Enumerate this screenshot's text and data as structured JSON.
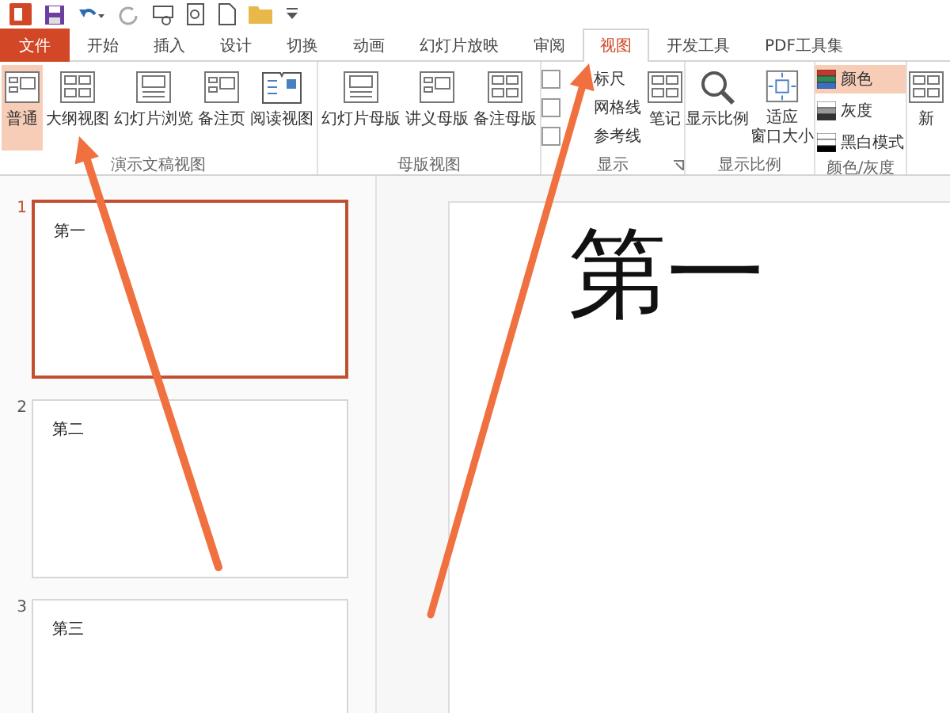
{
  "tabs": [
    {
      "label": "文件",
      "kind": "file"
    },
    {
      "label": "开始",
      "kind": "tab",
      "selected": false
    },
    {
      "label": "插入",
      "kind": "tab",
      "selected": false
    },
    {
      "label": "设计",
      "kind": "tab",
      "selected": false
    },
    {
      "label": "切换",
      "kind": "tab",
      "selected": false
    },
    {
      "label": "动画",
      "kind": "tab",
      "selected": false
    },
    {
      "label": "幻灯片放映",
      "kind": "tab",
      "selected": false
    },
    {
      "label": "审阅",
      "kind": "tab",
      "selected": false
    },
    {
      "label": "视图",
      "kind": "tab",
      "selected": true
    },
    {
      "label": "开发工具",
      "kind": "tab",
      "selected": false
    },
    {
      "label": "PDF工具集",
      "kind": "tab",
      "selected": false
    }
  ],
  "ribbon": {
    "groups": [
      {
        "label": "演示文稿视图",
        "items": [
          {
            "kind": "large",
            "label": "普通",
            "selected": true
          },
          {
            "kind": "large",
            "label": "大纲视图",
            "selected": false
          },
          {
            "kind": "large",
            "label": "幻灯片浏览",
            "selected": false
          },
          {
            "kind": "large",
            "label": "备注页",
            "selected": false
          },
          {
            "kind": "large",
            "label": "阅读视图",
            "selected": false
          }
        ]
      },
      {
        "label": "母版视图",
        "items": [
          {
            "kind": "large",
            "label": "幻灯片母版"
          },
          {
            "kind": "large",
            "label": "讲义母版"
          },
          {
            "kind": "large",
            "label": "备注母版"
          }
        ]
      },
      {
        "label": "显示",
        "launcher": true,
        "items": [
          {
            "kind": "check",
            "label": "标尺",
            "checked": false
          },
          {
            "kind": "check",
            "label": "网格线",
            "checked": false
          },
          {
            "kind": "check",
            "label": "参考线",
            "checked": false
          },
          {
            "kind": "large",
            "label": "笔记"
          }
        ]
      },
      {
        "label": "显示比例",
        "items": [
          {
            "kind": "large",
            "label": "显示比例"
          },
          {
            "kind": "large",
            "lines": [
              "适应",
              "窗口大小"
            ]
          }
        ]
      },
      {
        "label": "颜色/灰度",
        "items": [
          {
            "kind": "swatch",
            "label": "颜色",
            "selected": true
          },
          {
            "kind": "swatch",
            "label": "灰度",
            "selected": false
          },
          {
            "kind": "swatch",
            "label": "黑白模式",
            "selected": false
          }
        ]
      },
      {
        "items": [
          {
            "kind": "large",
            "label": "新"
          }
        ]
      }
    ]
  },
  "slides": [
    {
      "number": "1",
      "title": "第一",
      "selected": true
    },
    {
      "number": "2",
      "title": "第二",
      "selected": false
    },
    {
      "number": "3",
      "title": "第三",
      "selected": false
    }
  ],
  "editor": {
    "title": "第一"
  }
}
